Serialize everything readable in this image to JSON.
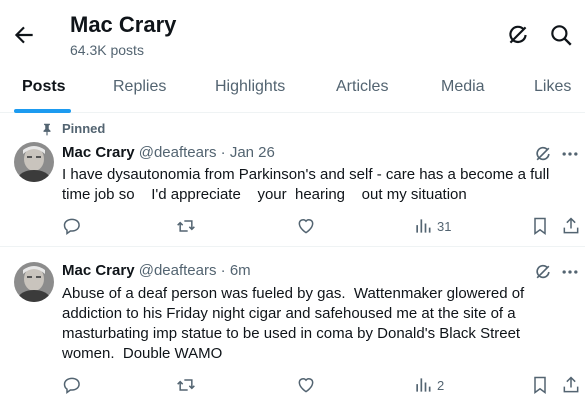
{
  "header": {
    "title": "Mac Crary",
    "post_count": "64.3K posts"
  },
  "tabs": [
    {
      "label": "Posts"
    },
    {
      "label": "Replies"
    },
    {
      "label": "Highlights"
    },
    {
      "label": "Articles"
    },
    {
      "label": "Media"
    },
    {
      "label": "Likes"
    }
  ],
  "tweets": [
    {
      "pinned_label": "Pinned",
      "name": "Mac Crary",
      "handle_time": "@deaftears · Jan 26",
      "text": "I have dysautonomia from Parkinson's and self - care has a become a full time job so    I'd appreciate    your  hearing    out my situation",
      "views": "31"
    },
    {
      "name": "Mac Crary",
      "handle_time": "@deaftears · 6m",
      "text": "Abuse of a deaf person was fueled by gas.  Wattenmaker glowered of addiction to his Friday night cigar and safehoused me at the site of a masturbating imp statue to be used in coma by Donald's Black Street women.  Double WAMO",
      "views": "2"
    }
  ],
  "icons": {
    "back": "arrow-left-icon",
    "grok": "grok-icon",
    "search": "search-icon",
    "pin": "pin-icon",
    "more": "more-icon",
    "reply": "reply-icon",
    "retweet": "retweet-icon",
    "like": "like-icon",
    "views": "views-icon",
    "bookmark": "bookmark-icon",
    "share": "share-icon"
  },
  "colors": {
    "accent": "#1d9bf0",
    "text": "#0f1419",
    "muted": "#536471"
  }
}
